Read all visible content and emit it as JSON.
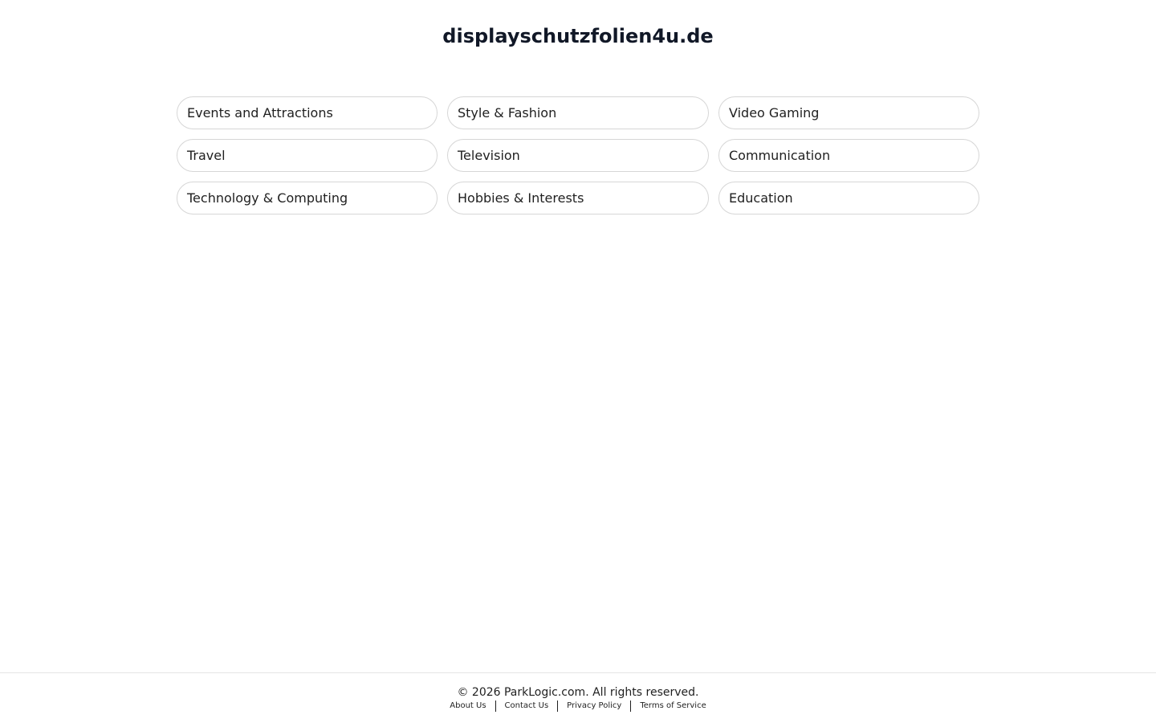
{
  "site": {
    "title": "displayschutzfolien4u.de"
  },
  "categories": [
    "Events and Attractions",
    "Style & Fashion",
    "Video Gaming",
    "Travel",
    "Television",
    "Communication",
    "Technology & Computing",
    "Hobbies & Interests",
    "Education"
  ],
  "footer": {
    "copyright": "© 2026 ParkLogic.com. All rights reserved.",
    "links": [
      "About Us",
      "Contact Us",
      "Privacy Policy",
      "Terms of Service"
    ]
  }
}
